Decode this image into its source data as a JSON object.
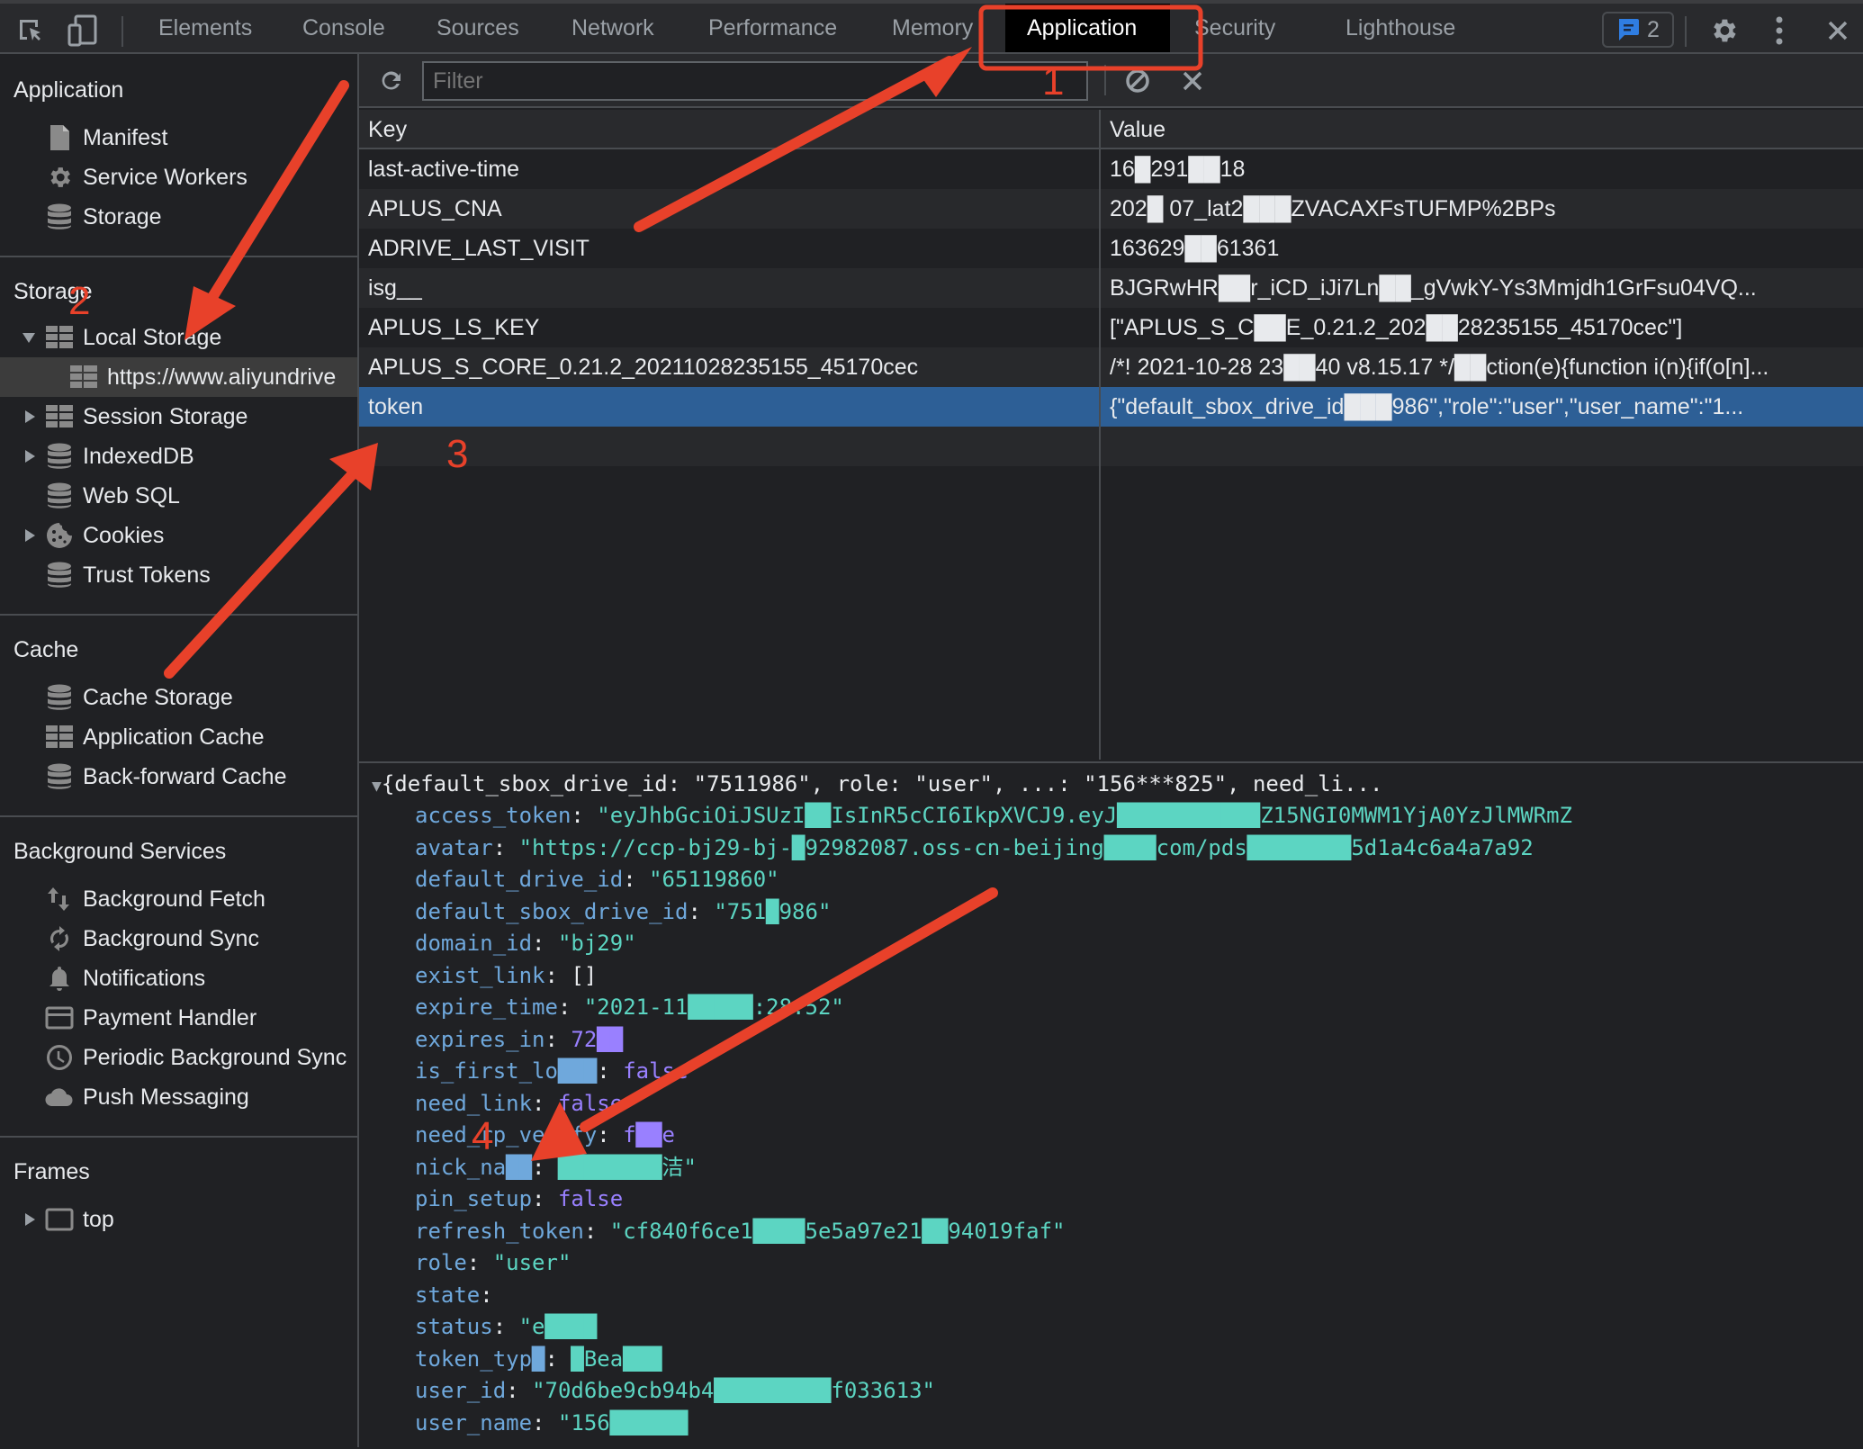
{
  "devtools": {
    "tabs": [
      {
        "label": "Elements"
      },
      {
        "label": "Console"
      },
      {
        "label": "Sources"
      },
      {
        "label": "Network"
      },
      {
        "label": "Performance"
      },
      {
        "label": "Memory"
      },
      {
        "label": "Application"
      },
      {
        "label": "Security"
      },
      {
        "label": "Lighthouse"
      }
    ],
    "active_tab": "Application",
    "issues_count": "2",
    "accent_color": "#2d5f96",
    "annotation_color": "#e8412a"
  },
  "sidebar": {
    "sections": {
      "application": {
        "title": "Application",
        "items": [
          {
            "label": "Manifest",
            "icon": "document-icon"
          },
          {
            "label": "Service Workers",
            "icon": "gear-icon"
          },
          {
            "label": "Storage",
            "icon": "database-icon"
          }
        ]
      },
      "storage": {
        "title": "Storage",
        "items": [
          {
            "label": "Local Storage",
            "icon": "table-icon",
            "expanded": true
          },
          {
            "label": "https://www.aliyundrive",
            "icon": "table-icon",
            "selected": true
          },
          {
            "label": "Session Storage",
            "icon": "table-icon",
            "expanded": false
          },
          {
            "label": "IndexedDB",
            "icon": "database-icon",
            "expanded": false
          },
          {
            "label": "Web SQL",
            "icon": "database-icon"
          },
          {
            "label": "Cookies",
            "icon": "cookie-icon",
            "expanded": false
          },
          {
            "label": "Trust Tokens",
            "icon": "database-icon"
          }
        ]
      },
      "cache": {
        "title": "Cache",
        "items": [
          {
            "label": "Cache Storage",
            "icon": "database-icon"
          },
          {
            "label": "Application Cache",
            "icon": "table-icon"
          },
          {
            "label": "Back-forward Cache",
            "icon": "database-icon"
          }
        ]
      },
      "background": {
        "title": "Background Services",
        "items": [
          {
            "label": "Background Fetch",
            "icon": "arrows-up-down-icon"
          },
          {
            "label": "Background Sync",
            "icon": "sync-icon"
          },
          {
            "label": "Notifications",
            "icon": "bell-icon"
          },
          {
            "label": "Payment Handler",
            "icon": "credit-card-icon"
          },
          {
            "label": "Periodic Background Sync",
            "icon": "clock-icon"
          },
          {
            "label": "Push Messaging",
            "icon": "cloud-icon"
          }
        ]
      },
      "frames": {
        "title": "Frames",
        "items": [
          {
            "label": "top",
            "icon": "frame-icon",
            "expanded": false
          }
        ]
      }
    }
  },
  "storage_view": {
    "filter_placeholder": "Filter",
    "columns": {
      "key": "Key",
      "value": "Value"
    },
    "rows": [
      {
        "key": "last-active-time",
        "value": "16█291██18"
      },
      {
        "key": "APLUS_CNA",
        "value": "202█ 07_lat2███ZVACAXFsTUFMP%2BPs"
      },
      {
        "key": "ADRIVE_LAST_VISIT",
        "value": "163629██61361"
      },
      {
        "key": "isg__",
        "value": "BJGRwHR██r_iCD_iJi7Ln██_gVwkY-Ys3Mmjdh1GrFsu04VQ..."
      },
      {
        "key": "APLUS_LS_KEY",
        "value": "[\"APLUS_S_C██E_0.21.2_202██28235155_45170cec\"]"
      },
      {
        "key": "APLUS_S_CORE_0.21.2_20211028235155_45170cec",
        "value": "/*! 2021-10-28 23██40 v8.15.17 */██ction(e){function i(n){if(o[n]..."
      },
      {
        "key": "token",
        "value": "{\"default_sbox_drive_id███986\",\"role\":\"user\",\"user_name\":\"1...",
        "selected": true
      }
    ]
  },
  "preview": {
    "summary": "{default_sbox_drive_id: \"7511986\", role: \"user\", ...: \"156***825\", need_li...",
    "fields": [
      {
        "key": "access_token",
        "value": "\"eyJhbGciOiJSUzI██IsInR5cCI6IkpXVCJ9.eyJ███████████Z15NGI0MWM1YjA0YzJlMWRmZ",
        "type": "string"
      },
      {
        "key": "avatar",
        "value": "\"https://ccp-bj29-bj-█92982087.oss-cn-beijing████com/pds████████5d1a4c6a4a7a92",
        "type": "string"
      },
      {
        "key": "default_drive_id",
        "value": "\"65119860\"",
        "type": "string"
      },
      {
        "key": "default_sbox_drive_id",
        "value": "\"751█986\"",
        "type": "string"
      },
      {
        "key": "domain_id",
        "value": "\"bj29\"",
        "type": "string"
      },
      {
        "key": "exist_link",
        "value": "[]",
        "type": "plain"
      },
      {
        "key": "expire_time",
        "value": "\"2021-11█████:28:52\"",
        "type": "string"
      },
      {
        "key": "expires_in",
        "value": "72██",
        "type": "bool"
      },
      {
        "key": "is_first_lo███",
        "value": "false",
        "type": "bool"
      },
      {
        "key": "need_link",
        "value": "false",
        "type": "bool"
      },
      {
        "key": "need_rp_verify",
        "value": "f██e",
        "type": "bool"
      },
      {
        "key": "nick_na██",
        "value": "████████洁\"",
        "type": "string"
      },
      {
        "key": "pin_setup",
        "value": "false",
        "type": "bool"
      },
      {
        "key": "refresh_token",
        "value": "\"cf840f6ce1████5e5a97e21██94019faf\"",
        "type": "string"
      },
      {
        "key": "role",
        "value": "\"user\"",
        "type": "string"
      },
      {
        "key": "state",
        "value": "",
        "type": "string"
      },
      {
        "key": "status",
        "value": "\"e████",
        "type": "string"
      },
      {
        "key": "token_typ█",
        "value": "█Bea███",
        "type": "string"
      },
      {
        "key": "user_id",
        "value": "\"70d6be9cb94b4█████████f033613\"",
        "type": "string"
      },
      {
        "key": "user_name",
        "value": "\"156██████",
        "type": "string"
      }
    ]
  },
  "annotations": [
    {
      "label": "1"
    },
    {
      "label": "2"
    },
    {
      "label": "3"
    },
    {
      "label": "4"
    }
  ]
}
